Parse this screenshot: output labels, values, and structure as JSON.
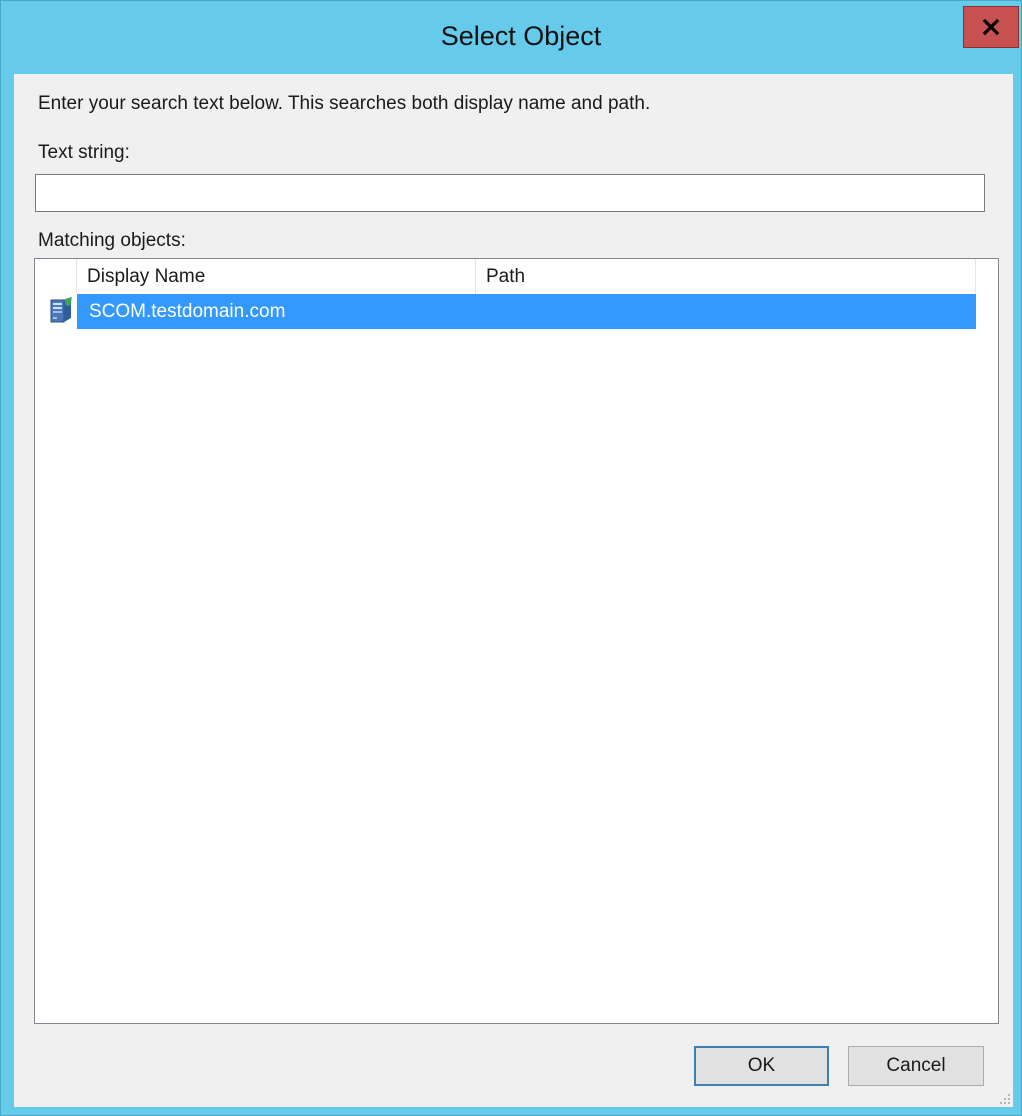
{
  "window": {
    "title": "Select Object",
    "close_glyph": "x"
  },
  "dialog": {
    "instruction": "Enter your search text below. This searches both display name and path.",
    "text_string_label": "Text string:",
    "search_value": "",
    "matching_label": "Matching objects:"
  },
  "list": {
    "columns": [
      "Display Name",
      "Path"
    ],
    "rows": [
      {
        "display_name": "SCOM.testdomain.com",
        "path": "",
        "icon": "computer-icon",
        "selected": true
      }
    ]
  },
  "buttons": {
    "ok": "OK",
    "cancel": "Cancel"
  },
  "colors": {
    "title_bar": "#66cbea",
    "close_button": "#c75050",
    "selection": "#3399ff"
  }
}
